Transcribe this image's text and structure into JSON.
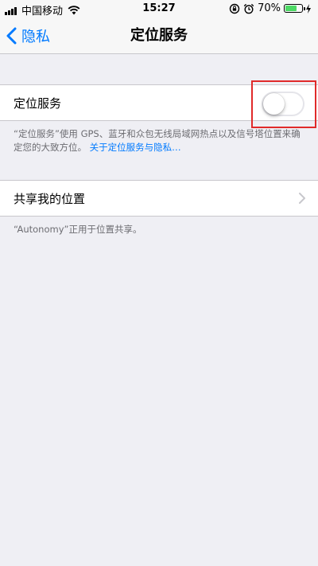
{
  "status_bar": {
    "carrier": "中国移动",
    "time": "15:27",
    "battery_percent": "70%",
    "battery_level": 0.7,
    "icons": [
      "signal-icon",
      "wifi-icon",
      "rotation-lock-icon",
      "alarm-icon",
      "battery-icon",
      "charging-icon"
    ]
  },
  "nav": {
    "back_label": "隐私",
    "title": "定位服务"
  },
  "location_services": {
    "label": "定位服务",
    "toggle_on": false,
    "description": "“定位服务”使用 GPS、蓝牙和众包无线局域网热点以及信号塔位置来确定您的大致方位。",
    "link": "关于定位服务与隐私…"
  },
  "share_location": {
    "label": "共享我的位置",
    "footnote": "“Autonomy”正用于位置共享。"
  },
  "colors": {
    "accent": "#007aff",
    "background": "#efeff4",
    "highlight": "#e02a2a",
    "battery": "#4cd964"
  }
}
